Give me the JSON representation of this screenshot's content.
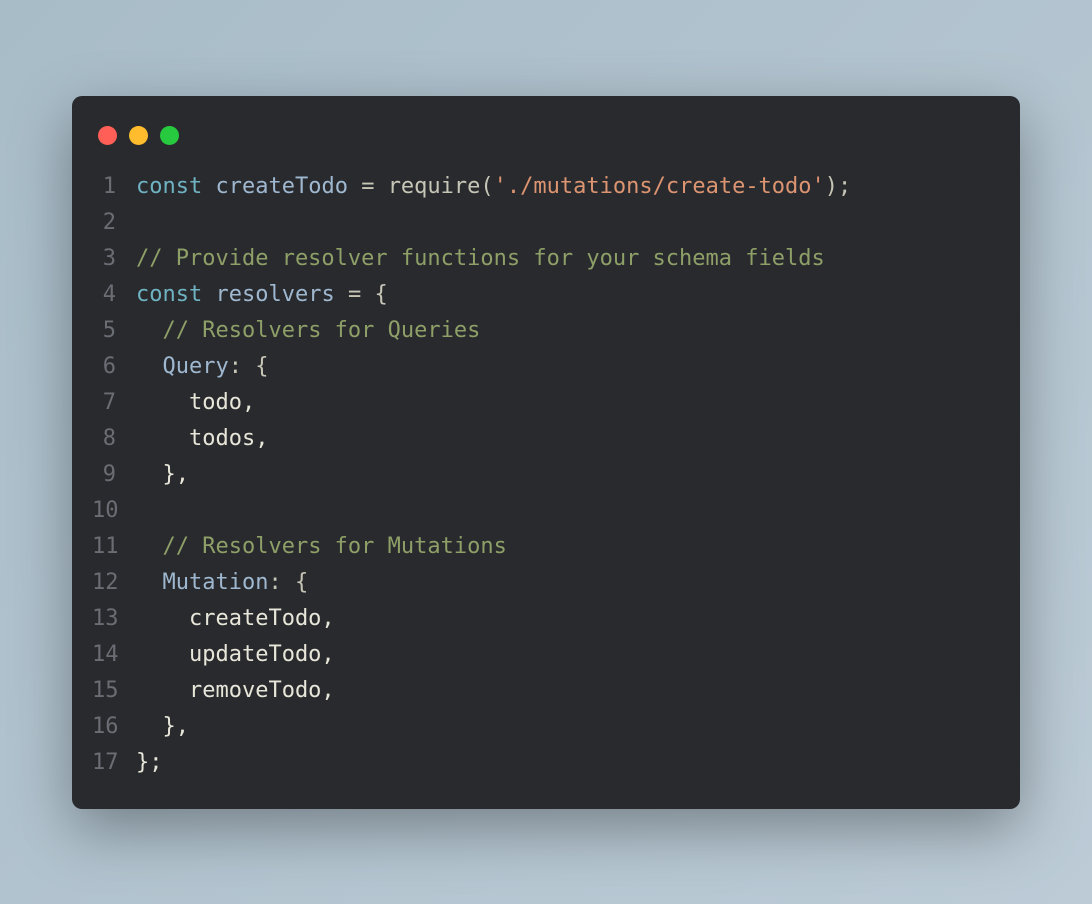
{
  "window": {
    "traffic_lights": {
      "close": "close",
      "minimize": "minimize",
      "maximize": "maximize"
    }
  },
  "colors": {
    "red": "#ff5f56",
    "yellow": "#ffbd2e",
    "green": "#27c93f",
    "bg": "#282a2e",
    "keyword": "#6fb3c3",
    "identifier": "#9fb8d0",
    "string": "#dd9471",
    "comment": "#8e9f67",
    "default": "#e8e6d9"
  },
  "code": {
    "lines": [
      {
        "n": "1",
        "tokens": [
          {
            "t": "const ",
            "c": "kw"
          },
          {
            "t": "createTodo",
            "c": "ident"
          },
          {
            "t": " ",
            "c": "plain"
          },
          {
            "t": "=",
            "c": "punct"
          },
          {
            "t": " ",
            "c": "plain"
          },
          {
            "t": "require",
            "c": "fn"
          },
          {
            "t": "(",
            "c": "punct"
          },
          {
            "t": "'./mutations/create-todo'",
            "c": "str"
          },
          {
            "t": ");",
            "c": "punct"
          }
        ]
      },
      {
        "n": "2",
        "tokens": []
      },
      {
        "n": "3",
        "tokens": [
          {
            "t": "// Provide resolver functions for your schema fields",
            "c": "comment"
          }
        ]
      },
      {
        "n": "4",
        "tokens": [
          {
            "t": "const ",
            "c": "kw"
          },
          {
            "t": "resolvers",
            "c": "ident"
          },
          {
            "t": " ",
            "c": "plain"
          },
          {
            "t": "=",
            "c": "punct"
          },
          {
            "t": " ",
            "c": "plain"
          },
          {
            "t": "{",
            "c": "punct"
          }
        ]
      },
      {
        "n": "5",
        "tokens": [
          {
            "t": "  ",
            "c": "plain"
          },
          {
            "t": "// Resolvers for Queries",
            "c": "comment"
          }
        ]
      },
      {
        "n": "6",
        "tokens": [
          {
            "t": "  ",
            "c": "plain"
          },
          {
            "t": "Query",
            "c": "prop"
          },
          {
            "t": ": {",
            "c": "punct"
          }
        ]
      },
      {
        "n": "7",
        "tokens": [
          {
            "t": "    todo,",
            "c": "plain"
          }
        ]
      },
      {
        "n": "8",
        "tokens": [
          {
            "t": "    todos,",
            "c": "plain"
          }
        ]
      },
      {
        "n": "9",
        "tokens": [
          {
            "t": "  },",
            "c": "plain"
          }
        ]
      },
      {
        "n": "10",
        "tokens": []
      },
      {
        "n": "11",
        "tokens": [
          {
            "t": "  ",
            "c": "plain"
          },
          {
            "t": "// Resolvers for Mutations",
            "c": "comment"
          }
        ]
      },
      {
        "n": "12",
        "tokens": [
          {
            "t": "  ",
            "c": "plain"
          },
          {
            "t": "Mutation",
            "c": "prop"
          },
          {
            "t": ": {",
            "c": "punct"
          }
        ]
      },
      {
        "n": "13",
        "tokens": [
          {
            "t": "    createTodo,",
            "c": "plain"
          }
        ]
      },
      {
        "n": "14",
        "tokens": [
          {
            "t": "    updateTodo,",
            "c": "plain"
          }
        ]
      },
      {
        "n": "15",
        "tokens": [
          {
            "t": "    removeTodo,",
            "c": "plain"
          }
        ]
      },
      {
        "n": "16",
        "tokens": [
          {
            "t": "  },",
            "c": "plain"
          }
        ]
      },
      {
        "n": "17",
        "tokens": [
          {
            "t": "};",
            "c": "plain"
          }
        ]
      }
    ]
  }
}
